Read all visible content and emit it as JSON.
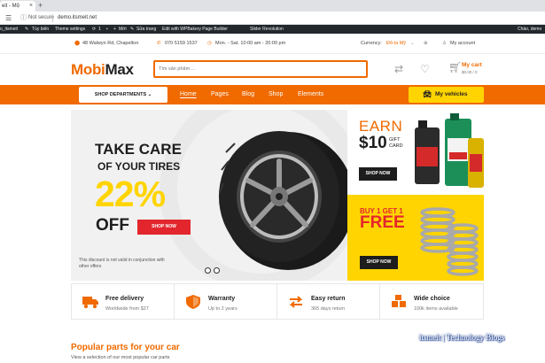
{
  "browser": {
    "tab_title": "eit - Mộ",
    "new_tab": "+",
    "url_secure": "Not secure",
    "url_text": "demo.itsmeit.net"
  },
  "wpbar": {
    "items": [
      "o_itsmeit",
      "Tùy biến",
      "Theme settings",
      "1",
      "Mới",
      "Sửa trang",
      "Edit with WPBakery Page Builder",
      "Slider Revolution"
    ],
    "greeting": "Chào, demo"
  },
  "topbar": {
    "address": "48 Walwyn Rd, Chapelton",
    "phone": "070 5159 1537",
    "hours": "Mon. - Sat. 10:00 am - 20:00 pm",
    "currency_label": "Currency:",
    "currency_value": "Đô-la Mỹ",
    "account": "My account"
  },
  "header": {
    "logo_part1": "Mobi",
    "logo_part2": "Max",
    "search_placeholder": "Tìm sản phẩm ...",
    "cart_title": "My cart",
    "cart_total": "$0.00 / 0"
  },
  "nav": {
    "departments": "SHOP DEPARTMENTS ⌄",
    "links": [
      "Home",
      "Pages",
      "Blog",
      "Shop",
      "Elements"
    ],
    "vehicles": "My vehicles"
  },
  "hero": {
    "line1": "TAKE CARE",
    "line2": "OF YOUR TIRES",
    "percent": "22%",
    "off": "OFF",
    "button": "SHOP NOW",
    "note": "This discount is not valid in conjunction with other offers"
  },
  "promo1": {
    "earn": "EARN",
    "amount": "$10",
    "gift": "GIFT CARD",
    "button": "SHOP NOW"
  },
  "promo2": {
    "line1": "BUY 1 GET 1",
    "line2": "FREE",
    "button": "SHOP NOW"
  },
  "features": [
    {
      "title": "Free delivery",
      "sub": "Worldwide from $27"
    },
    {
      "title": "Warranty",
      "sub": "Up to 2 years"
    },
    {
      "title": "Easy return",
      "sub": "365 days return"
    },
    {
      "title": "Wide choice",
      "sub": "100k items available"
    }
  ],
  "popular": {
    "title": "Popular parts for your car",
    "sub": "View a selection of our most popular car parts"
  },
  "watermark": "itsmeit | Technology Blogs",
  "colors": {
    "accent": "#f06a00",
    "yellow": "#ffd400",
    "red": "#e3262d",
    "dark": "#1d1d1d"
  }
}
